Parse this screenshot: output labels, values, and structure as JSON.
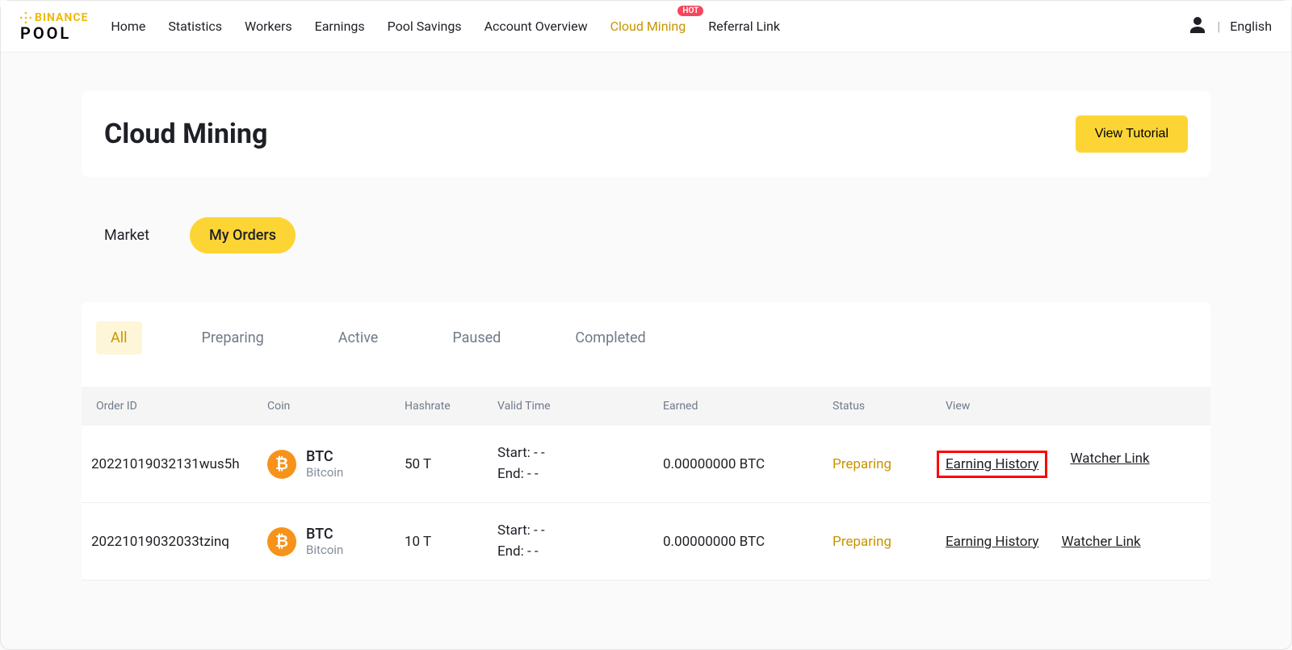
{
  "logo": {
    "line1": "BINANCE",
    "line2": "POOL"
  },
  "nav": {
    "items": [
      {
        "label": "Home"
      },
      {
        "label": "Statistics"
      },
      {
        "label": "Workers"
      },
      {
        "label": "Earnings"
      },
      {
        "label": "Pool Savings"
      },
      {
        "label": "Account Overview"
      },
      {
        "label": "Cloud Mining",
        "active": true,
        "badge": "HOT"
      },
      {
        "label": "Referral Link"
      }
    ]
  },
  "header_right": {
    "language": "English"
  },
  "page": {
    "title": "Cloud Mining",
    "tutorial_btn": "View Tutorial"
  },
  "section_tabs": [
    {
      "label": "Market"
    },
    {
      "label": "My Orders",
      "active": true
    }
  ],
  "filter_tabs": [
    {
      "label": "All",
      "active": true
    },
    {
      "label": "Preparing"
    },
    {
      "label": "Active"
    },
    {
      "label": "Paused"
    },
    {
      "label": "Completed"
    }
  ],
  "table": {
    "headers": {
      "order_id": "Order ID",
      "coin": "Coin",
      "hashrate": "Hashrate",
      "valid_time": "Valid Time",
      "earned": "Earned",
      "status": "Status",
      "view": "View"
    },
    "rows": [
      {
        "order_id": "20221019032131wus5h",
        "coin_symbol": "BTC",
        "coin_name": "Bitcoin",
        "coin_glyph": "₿",
        "hashrate": "50 T",
        "time_start": "Start: - -",
        "time_end": "End: - -",
        "earned": "0.00000000 BTC",
        "status": "Preparing",
        "link1": "Earning History",
        "link2": "Watcher Link",
        "highlight": true
      },
      {
        "order_id": "20221019032033tzinq",
        "coin_symbol": "BTC",
        "coin_name": "Bitcoin",
        "coin_glyph": "₿",
        "hashrate": "10 T",
        "time_start": "Start: - -",
        "time_end": "End: - -",
        "earned": "0.00000000 BTC",
        "status": "Preparing",
        "link1": "Earning History",
        "link2": "Watcher Link",
        "highlight": false
      }
    ]
  }
}
